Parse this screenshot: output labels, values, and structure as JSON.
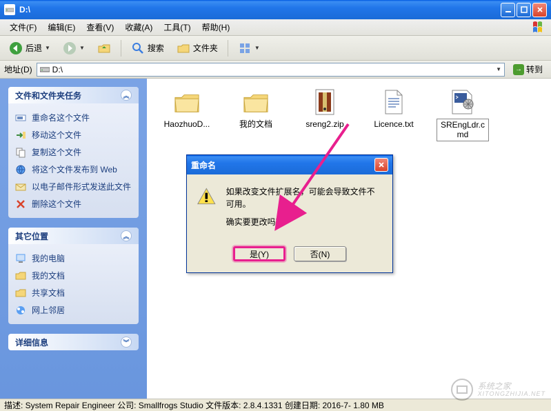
{
  "window": {
    "title": "D:\\"
  },
  "menus": {
    "file": "文件(F)",
    "edit": "编辑(E)",
    "view": "查看(V)",
    "favorites": "收藏(A)",
    "tools": "工具(T)",
    "help": "帮助(H)"
  },
  "toolbar": {
    "back": "后退",
    "search": "搜索",
    "folders": "文件夹"
  },
  "addressbar": {
    "label": "地址(D)",
    "value": "D:\\",
    "go": "转到"
  },
  "sidebar": {
    "tasks": {
      "title": "文件和文件夹任务",
      "items": [
        "重命名这个文件",
        "移动这个文件",
        "复制这个文件",
        "将这个文件发布到 Web",
        "以电子邮件形式发送此文件",
        "删除这个文件"
      ]
    },
    "places": {
      "title": "其它位置",
      "items": [
        "我的电脑",
        "我的文档",
        "共享文档",
        "网上邻居"
      ]
    },
    "details": {
      "title": "详细信息"
    }
  },
  "files": [
    {
      "name": "HaozhuoD...",
      "type": "folder"
    },
    {
      "name": "我的文档",
      "type": "folder"
    },
    {
      "name": "sreng2.zip",
      "type": "zip"
    },
    {
      "name": "Licence.txt",
      "type": "txt"
    },
    {
      "name": "SREngLdr.cmd",
      "type": "cmd",
      "selected": true
    }
  ],
  "dialog": {
    "title": "重命名",
    "line1": "如果改变文件扩展名，可能会导致文件不可用。",
    "line2": "确实要更改吗？",
    "yes": "是(Y)",
    "no": "否(N)"
  },
  "statusbar": {
    "text": "描述: System Repair Engineer 公司: Smallfrogs Studio 文件版本: 2.8.4.1331 创建日期: 2016-7-  1.80 MB"
  },
  "watermark": {
    "main": "系统之家",
    "sub": "XITONGZHIJIA.NET"
  }
}
